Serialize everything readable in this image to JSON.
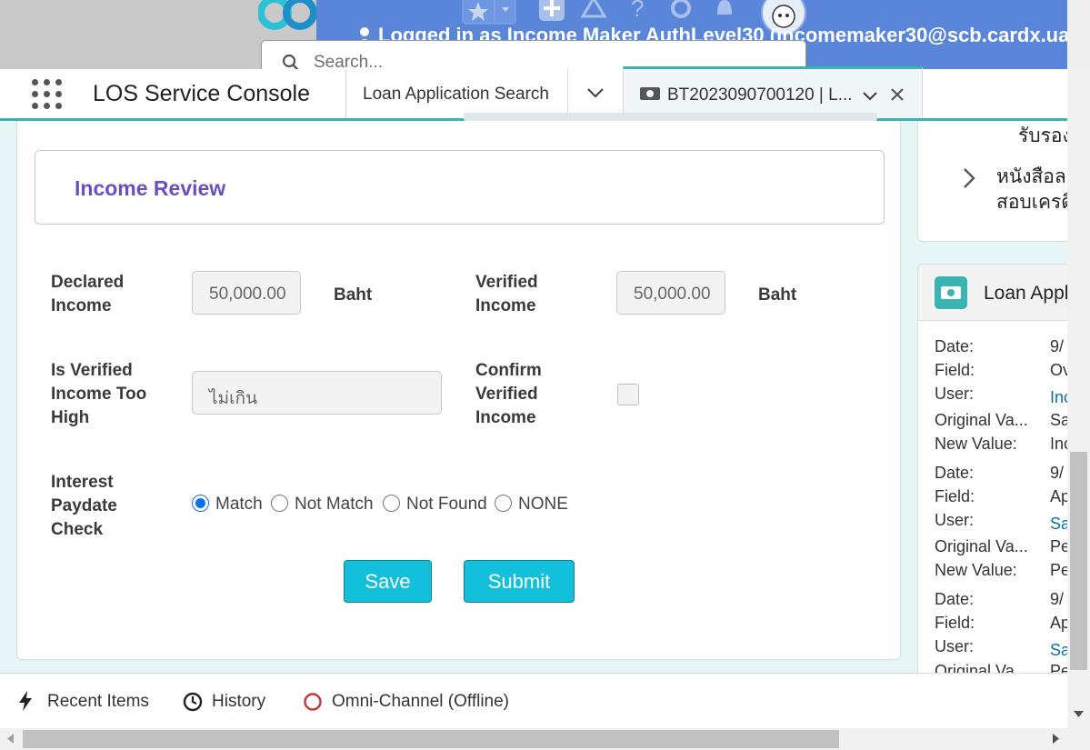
{
  "header": {
    "logged_in_text": "Logged in as Income Maker AuthLevel30 (incomemaker30@scb.cardx.ua"
  },
  "search": {
    "placeholder": "Search..."
  },
  "nav": {
    "app_name": "LOS Service Console",
    "tabs": [
      {
        "label": "Loan Application Search"
      },
      {
        "label": "BT2023090700120 | L..."
      }
    ]
  },
  "income_review": {
    "title": "Income Review",
    "declared_income": {
      "label": "Declared Income",
      "value": "50,000.00",
      "unit": "Baht"
    },
    "verified_income": {
      "label": "Verified Income",
      "value": "50,000.00",
      "unit": "Baht"
    },
    "is_verified_too_high": {
      "label": "Is Verified Income Too High",
      "value": "ไม่เกิน"
    },
    "confirm_verified_income": {
      "label": "Confirm Verified Income",
      "checked": false
    },
    "interest_paydate_check": {
      "label": "Interest Paydate Check",
      "options": [
        "Match",
        "Not Match",
        "Not Found",
        "NONE"
      ],
      "selected": "Match"
    },
    "buttons": {
      "save": "Save",
      "submit": "Submit"
    }
  },
  "right_panel": {
    "card1": {
      "line1": "รับรอง",
      "line2a": "หนังสือล",
      "line2b": "สอบเครดิ"
    },
    "history": {
      "title": "Loan Appl",
      "entries": [
        {
          "date_label": "Date:",
          "date": "9/",
          "field_label": "Field:",
          "field": "Ov",
          "user_label": "User:",
          "user": "Inc",
          "orig_label": "Original Va...",
          "orig": "Sa",
          "new_label": "New Value:",
          "new": "Inc"
        },
        {
          "date_label": "Date:",
          "date": "9/",
          "field_label": "Field:",
          "field": "Ap",
          "user_label": "User:",
          "user": "Sa",
          "orig_label": "Original Va...",
          "orig": "Pe",
          "new_label": "New Value:",
          "new": "Pe"
        },
        {
          "date_label": "Date:",
          "date": "9/",
          "field_label": "Field:",
          "field": "Ap",
          "user_label": "User:",
          "user": "Sa",
          "orig_label": "Original Va...",
          "orig": "Pe"
        }
      ]
    }
  },
  "utility_bar": {
    "recent_items": "Recent Items",
    "history": "History",
    "omni_channel": "Omni-Channel (Offline)"
  },
  "colors": {
    "accent_teal": "#3bb3b3",
    "button_cyan": "#12c0dc",
    "title_purple": "#6a4fc3",
    "banner_blue": "#5a86d9",
    "radio_blue": "#0b72e8",
    "offline_red": "#c23934"
  }
}
